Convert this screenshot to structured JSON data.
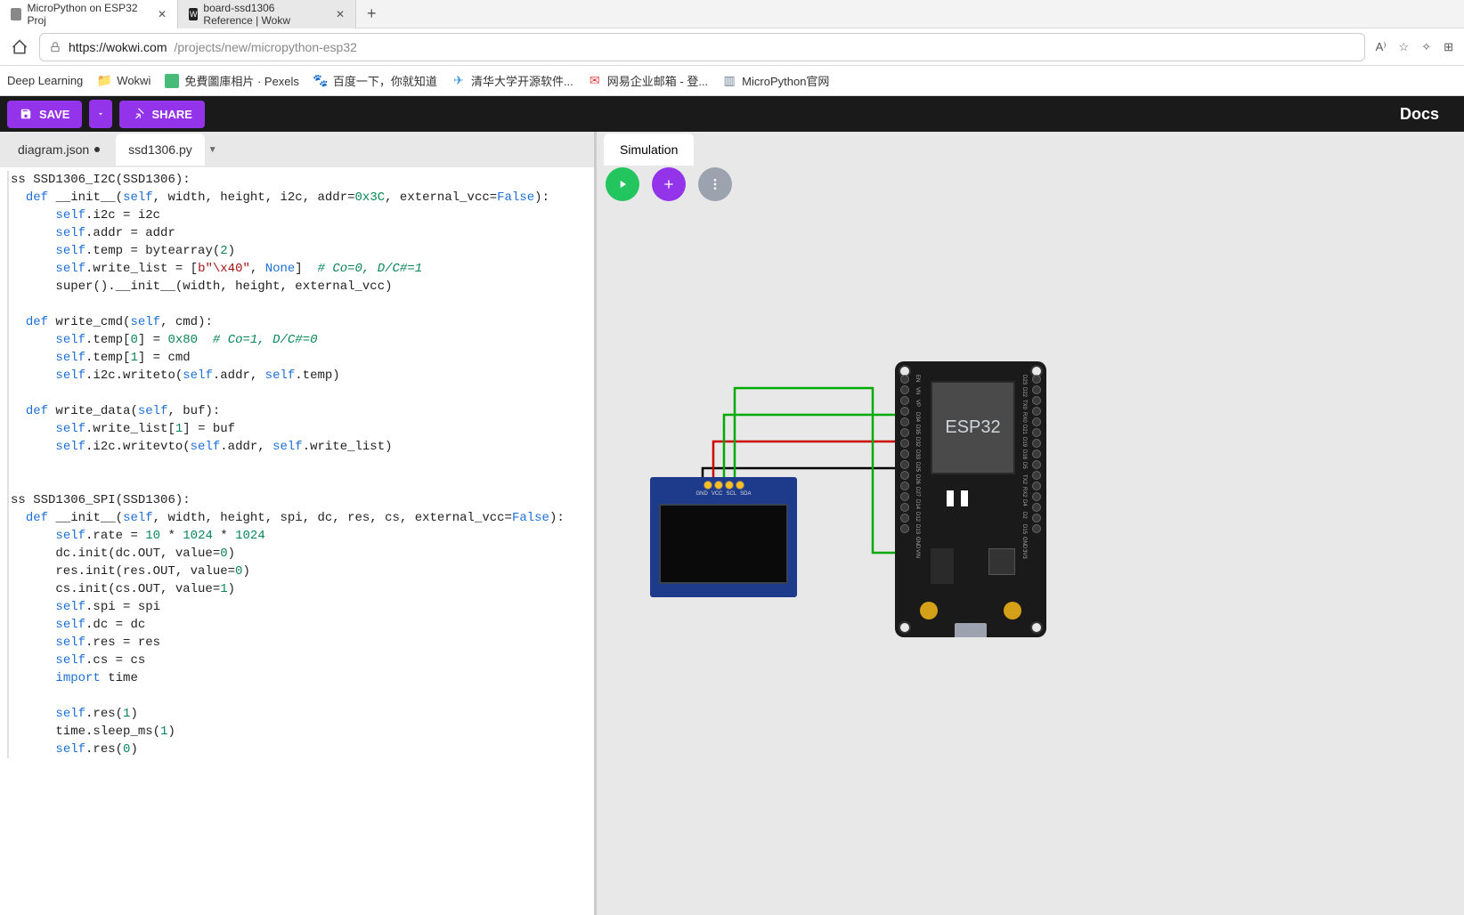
{
  "browser": {
    "tabs": [
      {
        "title": "MicroPython on ESP32 Proj"
      },
      {
        "title": "board-ssd1306 Reference | Wokw"
      }
    ],
    "url_host": "https://wokwi.com",
    "url_path": "/projects/new/micropython-esp32"
  },
  "bookmarks": [
    {
      "label": "Deep Learning"
    },
    {
      "label": "Wokwi"
    },
    {
      "label": "免費圖庫相片 · Pexels"
    },
    {
      "label": "百度一下，你就知道"
    },
    {
      "label": "清华大学开源软件..."
    },
    {
      "label": "网易企业邮箱 - 登..."
    },
    {
      "label": "MicroPython官网"
    }
  ],
  "toolbar": {
    "save_label": "SAVE",
    "share_label": "SHARE",
    "docs_label": "Docs"
  },
  "editor": {
    "tabs": [
      {
        "name": "diagram.json",
        "dirty": true
      },
      {
        "name": "ssd1306.py",
        "active": true
      }
    ]
  },
  "simulation": {
    "tab_label": "Simulation"
  },
  "esp32": {
    "chip_label": "ESP32",
    "pins_right": [
      "EN",
      "VN",
      "VP",
      "D34",
      "D35",
      "D32",
      "D33",
      "D25",
      "D26",
      "D27",
      "D14",
      "D12",
      "D13",
      "GND",
      "VIN"
    ],
    "pins_left": [
      "D23",
      "D22",
      "TX0",
      "RX0",
      "D21",
      "D19",
      "D18",
      "D5",
      "TX2",
      "RX2",
      "D4",
      "D2",
      "D15",
      "GND",
      "3V3"
    ]
  },
  "oled": {
    "pin_labels": [
      "GND",
      "VCC",
      "SCL",
      "SDA"
    ]
  },
  "code_tokens": [
    [
      {
        "t": "ss ",
        "c": ""
      },
      {
        "t": "SSD1306_I2C",
        "c": "fn"
      },
      {
        "t": "(",
        "c": ""
      },
      {
        "t": "SSD1306",
        "c": "fn"
      },
      {
        "t": "):",
        "c": ""
      }
    ],
    [
      {
        "t": "  ",
        "c": ""
      },
      {
        "t": "def",
        "c": "kw"
      },
      {
        "t": " ",
        "c": ""
      },
      {
        "t": "__init__",
        "c": "fn"
      },
      {
        "t": "(",
        "c": ""
      },
      {
        "t": "self",
        "c": "self"
      },
      {
        "t": ", width, height, i2c, addr=",
        "c": ""
      },
      {
        "t": "0x3C",
        "c": "num"
      },
      {
        "t": ", external_vcc=",
        "c": ""
      },
      {
        "t": "False",
        "c": "const"
      },
      {
        "t": "):",
        "c": ""
      }
    ],
    [
      {
        "t": "      ",
        "c": ""
      },
      {
        "t": "self",
        "c": "self"
      },
      {
        "t": ".i2c = i2c",
        "c": ""
      }
    ],
    [
      {
        "t": "      ",
        "c": ""
      },
      {
        "t": "self",
        "c": "self"
      },
      {
        "t": ".addr = addr",
        "c": ""
      }
    ],
    [
      {
        "t": "      ",
        "c": ""
      },
      {
        "t": "self",
        "c": "self"
      },
      {
        "t": ".temp = ",
        "c": ""
      },
      {
        "t": "bytearray",
        "c": "bif"
      },
      {
        "t": "(",
        "c": ""
      },
      {
        "t": "2",
        "c": "num"
      },
      {
        "t": ")",
        "c": ""
      }
    ],
    [
      {
        "t": "      ",
        "c": ""
      },
      {
        "t": "self",
        "c": "self"
      },
      {
        "t": ".write_list = [",
        "c": ""
      },
      {
        "t": "b\"\\x40\"",
        "c": "str"
      },
      {
        "t": ", ",
        "c": ""
      },
      {
        "t": "None",
        "c": "none"
      },
      {
        "t": "]  ",
        "c": ""
      },
      {
        "t": "# Co=0, D/C#=1",
        "c": "cmt"
      }
    ],
    [
      {
        "t": "      ",
        "c": ""
      },
      {
        "t": "super",
        "c": "bif"
      },
      {
        "t": "().",
        "c": ""
      },
      {
        "t": "__init__",
        "c": "fn"
      },
      {
        "t": "(width, height, external_vcc)",
        "c": ""
      }
    ],
    [
      {
        "t": " ",
        "c": ""
      }
    ],
    [
      {
        "t": "  ",
        "c": ""
      },
      {
        "t": "def",
        "c": "kw"
      },
      {
        "t": " write_cmd(",
        "c": ""
      },
      {
        "t": "self",
        "c": "self"
      },
      {
        "t": ", cmd):",
        "c": ""
      }
    ],
    [
      {
        "t": "      ",
        "c": ""
      },
      {
        "t": "self",
        "c": "self"
      },
      {
        "t": ".temp[",
        "c": ""
      },
      {
        "t": "0",
        "c": "num"
      },
      {
        "t": "] = ",
        "c": ""
      },
      {
        "t": "0x80",
        "c": "num"
      },
      {
        "t": "  ",
        "c": ""
      },
      {
        "t": "# Co=1, D/C#=0",
        "c": "cmt"
      }
    ],
    [
      {
        "t": "      ",
        "c": ""
      },
      {
        "t": "self",
        "c": "self"
      },
      {
        "t": ".temp[",
        "c": ""
      },
      {
        "t": "1",
        "c": "num"
      },
      {
        "t": "] = cmd",
        "c": ""
      }
    ],
    [
      {
        "t": "      ",
        "c": ""
      },
      {
        "t": "self",
        "c": "self"
      },
      {
        "t": ".i2c.writeto(",
        "c": ""
      },
      {
        "t": "self",
        "c": "self"
      },
      {
        "t": ".addr, ",
        "c": ""
      },
      {
        "t": "self",
        "c": "self"
      },
      {
        "t": ".temp)",
        "c": ""
      }
    ],
    [
      {
        "t": " ",
        "c": ""
      }
    ],
    [
      {
        "t": "  ",
        "c": ""
      },
      {
        "t": "def",
        "c": "kw"
      },
      {
        "t": " write_data(",
        "c": ""
      },
      {
        "t": "self",
        "c": "self"
      },
      {
        "t": ", buf):",
        "c": ""
      }
    ],
    [
      {
        "t": "      ",
        "c": ""
      },
      {
        "t": "self",
        "c": "self"
      },
      {
        "t": ".write_list[",
        "c": ""
      },
      {
        "t": "1",
        "c": "num"
      },
      {
        "t": "] = buf",
        "c": ""
      }
    ],
    [
      {
        "t": "      ",
        "c": ""
      },
      {
        "t": "self",
        "c": "self"
      },
      {
        "t": ".i2c.writevto(",
        "c": ""
      },
      {
        "t": "self",
        "c": "self"
      },
      {
        "t": ".addr, ",
        "c": ""
      },
      {
        "t": "self",
        "c": "self"
      },
      {
        "t": ".write_list)",
        "c": ""
      }
    ],
    [
      {
        "t": " ",
        "c": ""
      }
    ],
    [
      {
        "t": " ",
        "c": ""
      }
    ],
    [
      {
        "t": "ss ",
        "c": ""
      },
      {
        "t": "SSD1306_SPI",
        "c": "fn"
      },
      {
        "t": "(",
        "c": ""
      },
      {
        "t": "SSD1306",
        "c": "fn"
      },
      {
        "t": "):",
        "c": ""
      }
    ],
    [
      {
        "t": "  ",
        "c": ""
      },
      {
        "t": "def",
        "c": "kw"
      },
      {
        "t": " ",
        "c": ""
      },
      {
        "t": "__init__",
        "c": "fn"
      },
      {
        "t": "(",
        "c": ""
      },
      {
        "t": "self",
        "c": "self"
      },
      {
        "t": ", width, height, spi, dc, res, cs, external_vcc=",
        "c": ""
      },
      {
        "t": "False",
        "c": "const"
      },
      {
        "t": "):",
        "c": ""
      }
    ],
    [
      {
        "t": "      ",
        "c": ""
      },
      {
        "t": "self",
        "c": "self"
      },
      {
        "t": ".rate = ",
        "c": ""
      },
      {
        "t": "10",
        "c": "num"
      },
      {
        "t": " * ",
        "c": ""
      },
      {
        "t": "1024",
        "c": "num"
      },
      {
        "t": " * ",
        "c": ""
      },
      {
        "t": "1024",
        "c": "num"
      }
    ],
    [
      {
        "t": "      dc.init(dc.OUT, value=",
        "c": ""
      },
      {
        "t": "0",
        "c": "num"
      },
      {
        "t": ")",
        "c": ""
      }
    ],
    [
      {
        "t": "      res.init(res.OUT, value=",
        "c": ""
      },
      {
        "t": "0",
        "c": "num"
      },
      {
        "t": ")",
        "c": ""
      }
    ],
    [
      {
        "t": "      cs.init(cs.OUT, value=",
        "c": ""
      },
      {
        "t": "1",
        "c": "num"
      },
      {
        "t": ")",
        "c": ""
      }
    ],
    [
      {
        "t": "      ",
        "c": ""
      },
      {
        "t": "self",
        "c": "self"
      },
      {
        "t": ".spi = spi",
        "c": ""
      }
    ],
    [
      {
        "t": "      ",
        "c": ""
      },
      {
        "t": "self",
        "c": "self"
      },
      {
        "t": ".dc = dc",
        "c": ""
      }
    ],
    [
      {
        "t": "      ",
        "c": ""
      },
      {
        "t": "self",
        "c": "self"
      },
      {
        "t": ".res = res",
        "c": ""
      }
    ],
    [
      {
        "t": "      ",
        "c": ""
      },
      {
        "t": "self",
        "c": "self"
      },
      {
        "t": ".cs = cs",
        "c": ""
      }
    ],
    [
      {
        "t": "      ",
        "c": ""
      },
      {
        "t": "import",
        "c": "kw"
      },
      {
        "t": " time",
        "c": ""
      }
    ],
    [
      {
        "t": " ",
        "c": ""
      }
    ],
    [
      {
        "t": "      ",
        "c": ""
      },
      {
        "t": "self",
        "c": "self"
      },
      {
        "t": ".res(",
        "c": ""
      },
      {
        "t": "1",
        "c": "num"
      },
      {
        "t": ")",
        "c": ""
      }
    ],
    [
      {
        "t": "      time.sleep_ms(",
        "c": ""
      },
      {
        "t": "1",
        "c": "num"
      },
      {
        "t": ")",
        "c": ""
      }
    ],
    [
      {
        "t": "      ",
        "c": ""
      },
      {
        "t": "self",
        "c": "self"
      },
      {
        "t": ".res(",
        "c": ""
      },
      {
        "t": "0",
        "c": "num"
      },
      {
        "t": ")",
        "c": ""
      }
    ]
  ]
}
